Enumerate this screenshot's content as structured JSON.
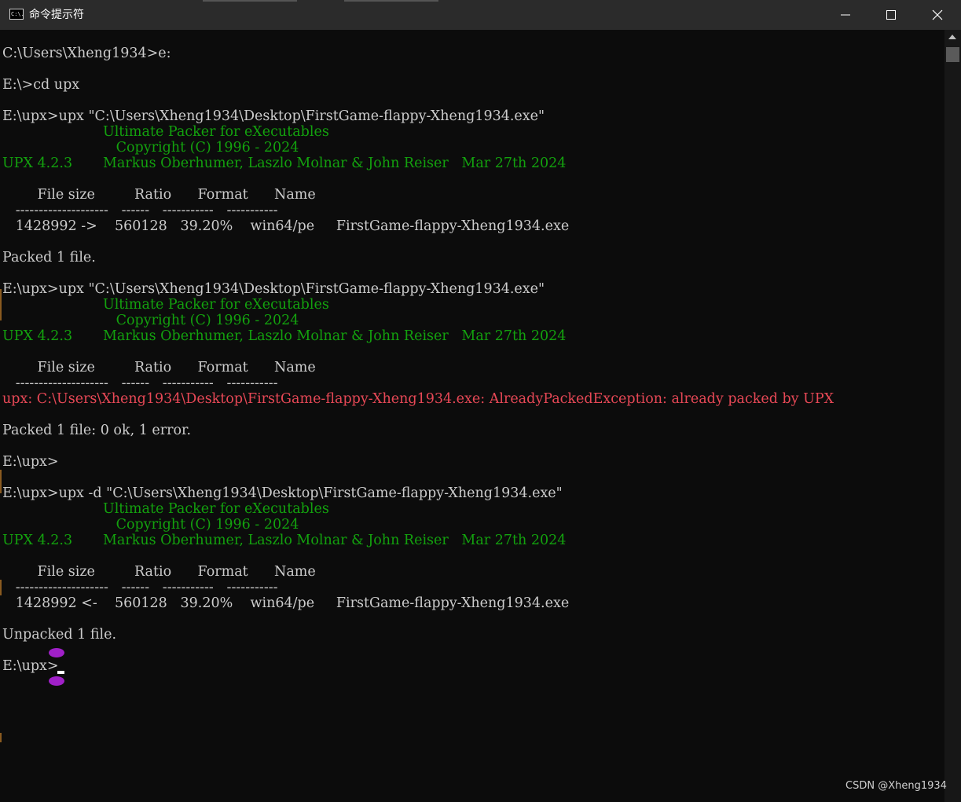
{
  "window": {
    "title": "命令提示符",
    "icon": "cmd-icon",
    "icon_text": "C:\\."
  },
  "console_lines": [
    {
      "text": "C:\\Users\\Xheng1934>e:",
      "color": "white"
    },
    {
      "text": "",
      "color": "white"
    },
    {
      "text": "E:\\>cd upx",
      "color": "white"
    },
    {
      "text": "",
      "color": "white"
    },
    {
      "text": "E:\\upx>upx \"C:\\Users\\Xheng1934\\Desktop\\FirstGame-flappy-Xheng1934.exe\"",
      "color": "white"
    },
    {
      "text": "                       Ultimate Packer for eXecutables",
      "color": "green"
    },
    {
      "text": "                          Copyright (C) 1996 - 2024",
      "color": "green"
    },
    {
      "text": "UPX 4.2.3       Markus Oberhumer, Laszlo Molnar & John Reiser   Mar 27th 2024",
      "color": "green"
    },
    {
      "text": "",
      "color": "white"
    },
    {
      "text": "        File size         Ratio      Format      Name",
      "color": "white"
    },
    {
      "text": "   --------------------   ------   -----------   -----------",
      "color": "white"
    },
    {
      "text": "   1428992 ->    560128   39.20%    win64/pe     FirstGame-flappy-Xheng1934.exe",
      "color": "white"
    },
    {
      "text": "",
      "color": "white"
    },
    {
      "text": "Packed 1 file.",
      "color": "white"
    },
    {
      "text": "",
      "color": "white"
    },
    {
      "text": "E:\\upx>upx \"C:\\Users\\Xheng1934\\Desktop\\FirstGame-flappy-Xheng1934.exe\"",
      "color": "white"
    },
    {
      "text": "                       Ultimate Packer for eXecutables",
      "color": "green"
    },
    {
      "text": "                          Copyright (C) 1996 - 2024",
      "color": "green"
    },
    {
      "text": "UPX 4.2.3       Markus Oberhumer, Laszlo Molnar & John Reiser   Mar 27th 2024",
      "color": "green"
    },
    {
      "text": "",
      "color": "white"
    },
    {
      "text": "        File size         Ratio      Format      Name",
      "color": "white"
    },
    {
      "text": "   --------------------   ------   -----------   -----------",
      "color": "white"
    },
    {
      "text": "upx: C:\\Users\\Xheng1934\\Desktop\\FirstGame-flappy-Xheng1934.exe: AlreadyPackedException: already packed by UPX",
      "color": "red"
    },
    {
      "text": "",
      "color": "white"
    },
    {
      "text": "Packed 1 file: 0 ok, 1 error.",
      "color": "white"
    },
    {
      "text": "",
      "color": "white"
    },
    {
      "text": "E:\\upx>",
      "color": "white"
    },
    {
      "text": "",
      "color": "white"
    },
    {
      "text": "E:\\upx>upx -d \"C:\\Users\\Xheng1934\\Desktop\\FirstGame-flappy-Xheng1934.exe\"",
      "color": "white"
    },
    {
      "text": "                       Ultimate Packer for eXecutables",
      "color": "green"
    },
    {
      "text": "                          Copyright (C) 1996 - 2024",
      "color": "green"
    },
    {
      "text": "UPX 4.2.3       Markus Oberhumer, Laszlo Molnar & John Reiser   Mar 27th 2024",
      "color": "green"
    },
    {
      "text": "",
      "color": "white"
    },
    {
      "text": "        File size         Ratio      Format      Name",
      "color": "white"
    },
    {
      "text": "   --------------------   ------   -----------   -----------",
      "color": "white"
    },
    {
      "text": "   1428992 <-    560128   39.20%    win64/pe     FirstGame-flappy-Xheng1934.exe",
      "color": "white"
    },
    {
      "text": "",
      "color": "white"
    },
    {
      "text": "Unpacked 1 file.",
      "color": "white"
    },
    {
      "text": "",
      "color": "white"
    },
    {
      "text": "E:\\upx>",
      "color": "white"
    }
  ],
  "colors": {
    "background": "#0c0c0c",
    "white": "#cccccc",
    "green": "#13a10e",
    "red": "#e74856",
    "ime_indicator": "#a020c8"
  },
  "watermark": "CSDN @Xheng1934"
}
